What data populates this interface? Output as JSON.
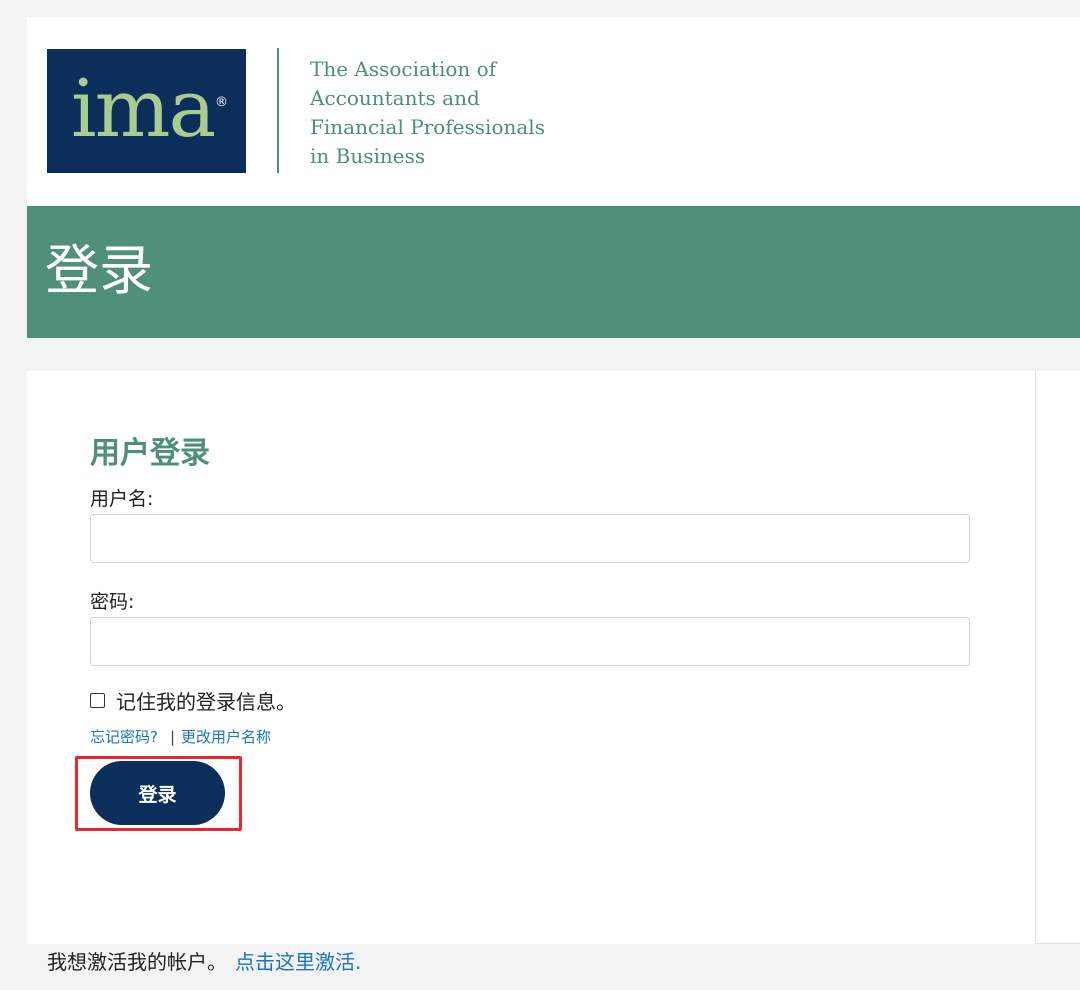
{
  "header": {
    "logo": {
      "text": "ima",
      "registered_mark": "®"
    },
    "tagline": [
      "The Association of",
      "Accountants and",
      "Financial Professionals",
      "in Business"
    ]
  },
  "title_band": {
    "title": "登录"
  },
  "login_form": {
    "heading": "用户登录",
    "username_label": "用户名:",
    "username_value": "",
    "password_label": "密码:",
    "password_value": "",
    "remember_label": "记住我的登录信息。",
    "remember_checked": false,
    "forgot_password_link": "忘记密码?",
    "separator": "|",
    "change_username_link": "更改用户名称",
    "submit_label": "登录"
  },
  "footer": {
    "activate_text": "我想激活我的帐户。",
    "activate_link": "点击这里激活."
  },
  "colors": {
    "page_background": "#f3f3f3",
    "brand_navy": "#0b2f5a",
    "brand_green": "#508f78",
    "logo_green": "#a9cc91",
    "link_blue": "#1a74c8",
    "highlight_red": "#e42a2a"
  }
}
